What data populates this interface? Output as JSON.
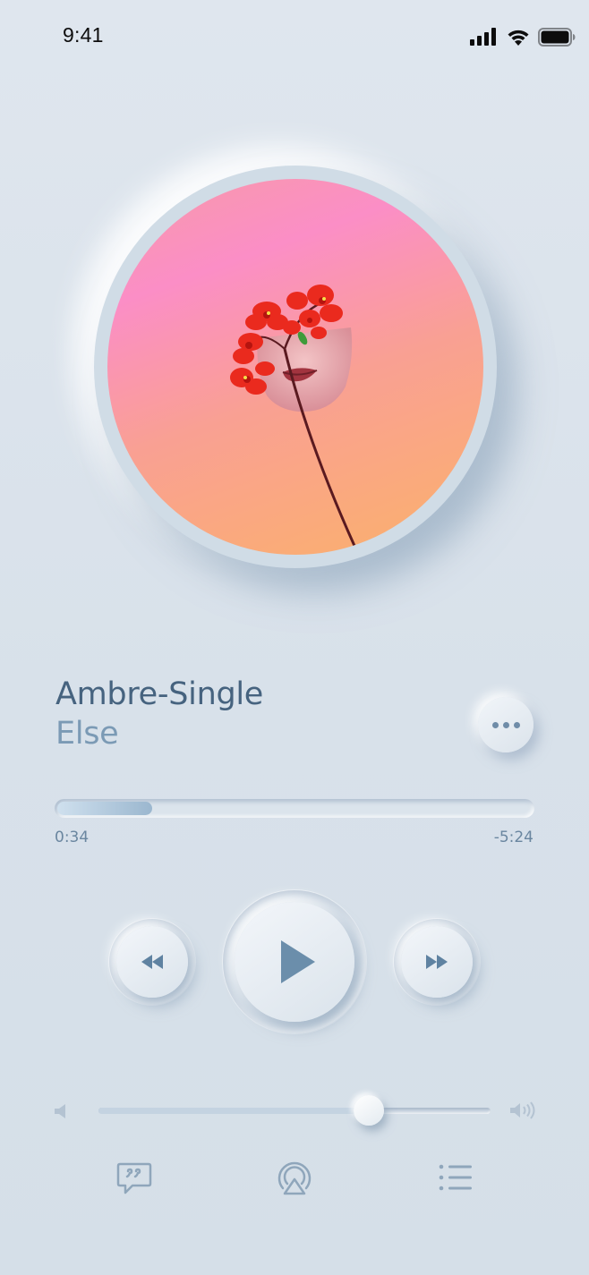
{
  "status_bar": {
    "time": "9:41",
    "signal_icon": "cellular-signal-icon",
    "wifi_icon": "wifi-icon",
    "battery_icon": "battery-icon"
  },
  "album": {
    "artwork": "album-artwork-flower-face"
  },
  "track": {
    "title": "Ambre-Single",
    "artist": "Else",
    "more_icon": "more-options-icon"
  },
  "progress": {
    "elapsed": "0:34",
    "remaining": "-5:24",
    "fraction": 0.2
  },
  "controls": {
    "rewind_icon": "rewind-icon",
    "play_icon": "play-icon",
    "forward_icon": "fast-forward-icon"
  },
  "volume": {
    "low_icon": "volume-low-icon",
    "high_icon": "volume-high-icon",
    "level": 0.69
  },
  "bottom_bar": {
    "lyrics_icon": "lyrics-icon",
    "airplay_icon": "airplay-icon",
    "queue_icon": "queue-list-icon"
  },
  "colors": {
    "accent": "#6b8eab",
    "title": "#46637f",
    "artist": "#7b9ab5",
    "background": "#dbe3eb"
  }
}
